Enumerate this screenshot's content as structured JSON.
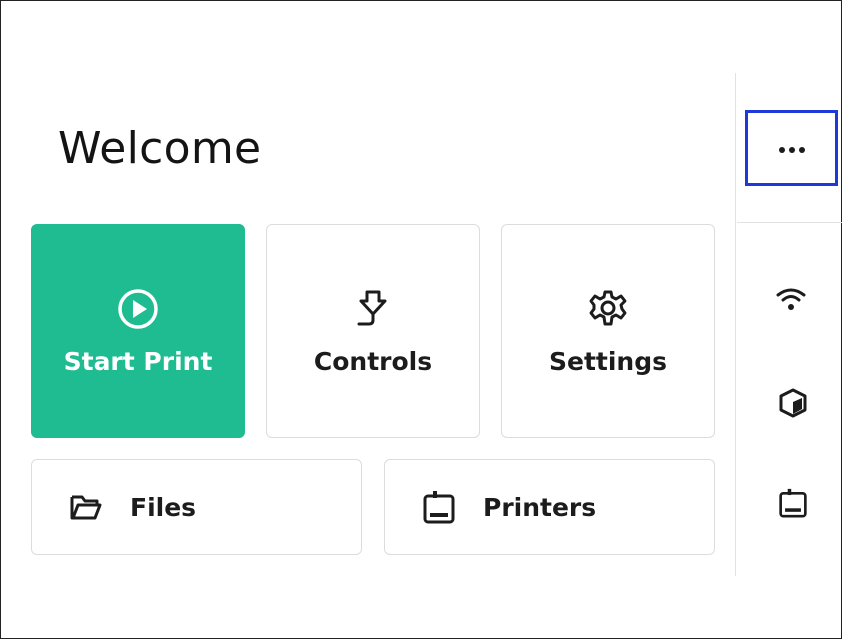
{
  "header": {
    "title": "Welcome"
  },
  "tiles": [
    {
      "label": "Start Print",
      "icon": "play-circle-icon"
    },
    {
      "label": "Controls",
      "icon": "extruder-icon"
    },
    {
      "label": "Settings",
      "icon": "gear-icon"
    }
  ],
  "wide_tiles": [
    {
      "label": "Files",
      "icon": "folder-icon"
    },
    {
      "label": "Printers",
      "icon": "printer-icon"
    }
  ],
  "sidebar": {
    "more_icon": "more-horizontal-icon",
    "status_icons": [
      "wifi-icon",
      "filament-cube-icon",
      "printer-icon"
    ]
  },
  "colors": {
    "accent": "#1fbb91",
    "highlight": "#1e3ad6",
    "border": "#dcdcdc"
  }
}
